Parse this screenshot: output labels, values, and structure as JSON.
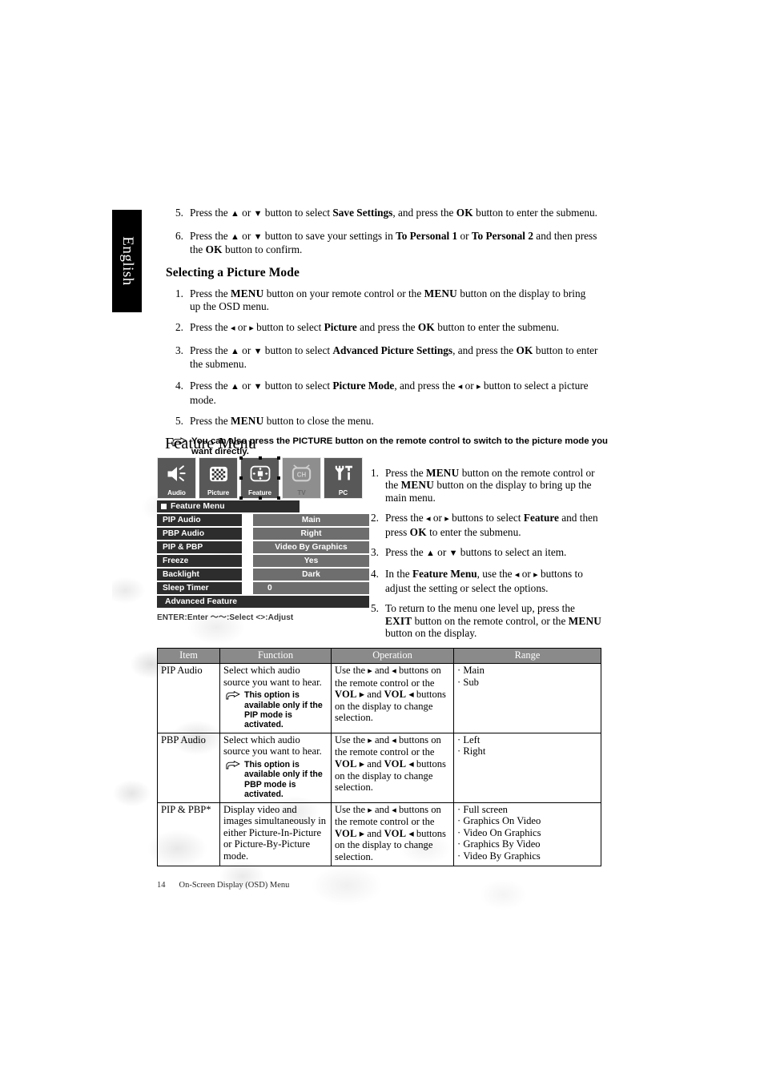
{
  "language_tab": "English",
  "top_steps": [
    {
      "num": "5.",
      "html_parts": [
        {
          "t": "Press the "
        },
        {
          "t": "▲",
          "style": "arrow"
        },
        {
          "t": " or "
        },
        {
          "t": "▼",
          "style": "arrow"
        },
        {
          "t": " button to select "
        },
        {
          "t": "Save Settings",
          "style": "bold"
        },
        {
          "t": ", and press the "
        },
        {
          "t": "OK",
          "style": "smallcaps"
        },
        {
          "t": " button to enter the submenu."
        }
      ]
    },
    {
      "num": "6.",
      "html_parts": [
        {
          "t": "Press the "
        },
        {
          "t": "▲",
          "style": "arrow"
        },
        {
          "t": " or "
        },
        {
          "t": "▼",
          "style": "arrow"
        },
        {
          "t": " button to save your settings in "
        },
        {
          "t": "To Personal 1",
          "style": "bold"
        },
        {
          "t": " or "
        },
        {
          "t": "To Personal 2",
          "style": "bold"
        },
        {
          "t": " and then press the "
        },
        {
          "t": "OK",
          "style": "smallcaps"
        },
        {
          "t": " button to confirm."
        }
      ]
    }
  ],
  "section_heading": "Selecting a Picture Mode",
  "picture_mode_steps": [
    {
      "num": "1.",
      "html_parts": [
        {
          "t": "Press the "
        },
        {
          "t": "MENU",
          "style": "smallcaps"
        },
        {
          "t": " button on your remote control or the "
        },
        {
          "t": "MENU",
          "style": "smallcaps"
        },
        {
          "t": " button on the display to bring up the OSD menu."
        }
      ]
    },
    {
      "num": "2.",
      "html_parts": [
        {
          "t": "Press the "
        },
        {
          "t": "◂",
          "style": "arrow"
        },
        {
          "t": " or "
        },
        {
          "t": "▸",
          "style": "arrow"
        },
        {
          "t": " button to select "
        },
        {
          "t": "Picture",
          "style": "bold"
        },
        {
          "t": " and press the "
        },
        {
          "t": "OK",
          "style": "smallcaps"
        },
        {
          "t": " button to enter the submenu."
        }
      ]
    },
    {
      "num": "3.",
      "html_parts": [
        {
          "t": "Press the "
        },
        {
          "t": "▲",
          "style": "arrow"
        },
        {
          "t": " or "
        },
        {
          "t": "▼",
          "style": "arrow"
        },
        {
          "t": " button to select "
        },
        {
          "t": "Advanced Picture Settings",
          "style": "bold"
        },
        {
          "t": ", and press the "
        },
        {
          "t": "OK",
          "style": "smallcaps"
        },
        {
          "t": " button to enter the submenu."
        }
      ]
    },
    {
      "num": "4.",
      "html_parts": [
        {
          "t": "Press the "
        },
        {
          "t": "▲",
          "style": "arrow"
        },
        {
          "t": " or "
        },
        {
          "t": "▼",
          "style": "arrow"
        },
        {
          "t": " button to select "
        },
        {
          "t": "Picture Mode",
          "style": "bold"
        },
        {
          "t": ", and press the "
        },
        {
          "t": "◂",
          "style": "arrow"
        },
        {
          "t": " or "
        },
        {
          "t": "▸",
          "style": "arrow"
        },
        {
          "t": " button to select a picture mode."
        }
      ]
    },
    {
      "num": "5.",
      "html_parts": [
        {
          "t": "Press the "
        },
        {
          "t": "MENU",
          "style": "smallcaps"
        },
        {
          "t": " button to close the menu."
        }
      ]
    }
  ],
  "tip_note": "You can also press the PICTURE button on the remote control to switch to the picture mode you want directly.",
  "feature_menu_heading": "Feature Menu",
  "osd": {
    "tabs": [
      {
        "label": "Audio",
        "icon": "speaker-icon",
        "state": "normal"
      },
      {
        "label": "Picture",
        "icon": "checker-icon",
        "state": "normal"
      },
      {
        "label": "Feature",
        "icon": "crosspad-icon",
        "state": "selected"
      },
      {
        "label": "TV",
        "icon": "tv-icon",
        "state": "disabled"
      },
      {
        "label": "PC",
        "icon": "tools-icon",
        "state": "normal"
      }
    ],
    "title": "Feature Menu",
    "rows": [
      {
        "key": "PIP Audio",
        "value": "Main"
      },
      {
        "key": "PBP Audio",
        "value": "Right"
      },
      {
        "key": "PIP & PBP",
        "value": "Video By Graphics"
      },
      {
        "key": "Freeze",
        "value": "Yes"
      },
      {
        "key": "Backlight",
        "value": "Dark"
      },
      {
        "key": "Sleep Timer",
        "value": "0"
      }
    ],
    "advanced_item": "Advanced Feature",
    "hint_bar": "ENTER:Enter  ～～:Select  <>:Adjust"
  },
  "osd_steps": [
    {
      "num": "1.",
      "html_parts": [
        {
          "t": "Press the "
        },
        {
          "t": "MENU",
          "style": "smallcaps"
        },
        {
          "t": " button on the remote control or the "
        },
        {
          "t": "MENU",
          "style": "smallcaps"
        },
        {
          "t": " button on the display to bring up the main menu."
        }
      ]
    },
    {
      "num": "2.",
      "html_parts": [
        {
          "t": "Press the "
        },
        {
          "t": "◂",
          "style": "arrow"
        },
        {
          "t": " or "
        },
        {
          "t": "▸",
          "style": "arrow"
        },
        {
          "t": " buttons to select "
        },
        {
          "t": "Feature",
          "style": "bold"
        },
        {
          "t": " and then press "
        },
        {
          "t": "OK",
          "style": "smallcaps"
        },
        {
          "t": " to enter the submenu."
        }
      ]
    },
    {
      "num": "3.",
      "html_parts": [
        {
          "t": "Press the "
        },
        {
          "t": "▲",
          "style": "arrow"
        },
        {
          "t": " or "
        },
        {
          "t": "▼",
          "style": "arrow"
        },
        {
          "t": " buttons to select an item."
        }
      ]
    },
    {
      "num": "4.",
      "html_parts": [
        {
          "t": "In the "
        },
        {
          "t": "Feature Menu",
          "style": "bold"
        },
        {
          "t": ", use the "
        },
        {
          "t": "◂",
          "style": "arrow"
        },
        {
          "t": " or "
        },
        {
          "t": "▸",
          "style": "arrow"
        },
        {
          "t": " buttons to adjust the setting or select the options."
        }
      ]
    },
    {
      "num": "5.",
      "html_parts": [
        {
          "t": "To return to the menu one level up, press the "
        },
        {
          "t": "EXIT",
          "style": "smallcaps"
        },
        {
          "t": " button on the remote control, or the "
        },
        {
          "t": "MENU",
          "style": "smallcaps"
        },
        {
          "t": " button on the display."
        }
      ]
    }
  ],
  "table": {
    "headers": [
      "Item",
      "Function",
      "Operation",
      "Range"
    ],
    "rows": [
      {
        "item": "PIP Audio",
        "function": "Select which audio source you want to hear.",
        "function_note": "This option is available only if the PIP mode is activated.",
        "operation_parts": [
          {
            "t": "Use the "
          },
          {
            "t": "▸",
            "style": "arrow"
          },
          {
            "t": " and "
          },
          {
            "t": "◂",
            "style": "arrow"
          },
          {
            "t": " buttons on the remote control or the "
          },
          {
            "t": "VOL",
            "style": "smallcaps"
          },
          {
            "t": " ▸ and "
          },
          {
            "t": "VOL",
            "style": "smallcaps"
          },
          {
            "t": " ◂ buttons on the display to change selection."
          }
        ],
        "range": [
          "Main",
          "Sub"
        ]
      },
      {
        "item": "PBP Audio",
        "function": "Select which audio source you want to hear.",
        "function_note": "This option is available only if the PBP mode is activated.",
        "operation_parts": [
          {
            "t": "Use the "
          },
          {
            "t": "▸",
            "style": "arrow"
          },
          {
            "t": " and "
          },
          {
            "t": "◂",
            "style": "arrow"
          },
          {
            "t": " buttons on the remote control or the "
          },
          {
            "t": "VOL",
            "style": "smallcaps"
          },
          {
            "t": " ▸ and "
          },
          {
            "t": "VOL",
            "style": "smallcaps"
          },
          {
            "t": " ◂ buttons on the display to change selection."
          }
        ],
        "range": [
          "Left",
          "Right"
        ]
      },
      {
        "item": "PIP & PBP*",
        "function": "Display video and images simultaneously in either Picture-In-Picture or Picture-By-Picture mode.",
        "function_note": "",
        "operation_parts": [
          {
            "t": "Use the "
          },
          {
            "t": "▸",
            "style": "arrow"
          },
          {
            "t": " and "
          },
          {
            "t": "◂",
            "style": "arrow"
          },
          {
            "t": " buttons on the remote control or the "
          },
          {
            "t": "VOL",
            "style": "smallcaps"
          },
          {
            "t": " ▸ and "
          },
          {
            "t": "VOL",
            "style": "smallcaps"
          },
          {
            "t": " ◂ buttons on the display to change selection."
          }
        ],
        "range": [
          "Full screen",
          "Graphics On Video",
          "Video On Graphics",
          "Graphics By Video",
          "Video By Graphics"
        ]
      }
    ]
  },
  "footer": {
    "page_number": "14",
    "section": "On-Screen Display (OSD) Menu"
  },
  "colors": {
    "osd_dark": "#2d2d2d",
    "osd_value": "#6e6e6e",
    "osd_tab": "#585858",
    "osd_tab_disabled": "#8e8e8e",
    "table_header": "#8a8a8a"
  }
}
